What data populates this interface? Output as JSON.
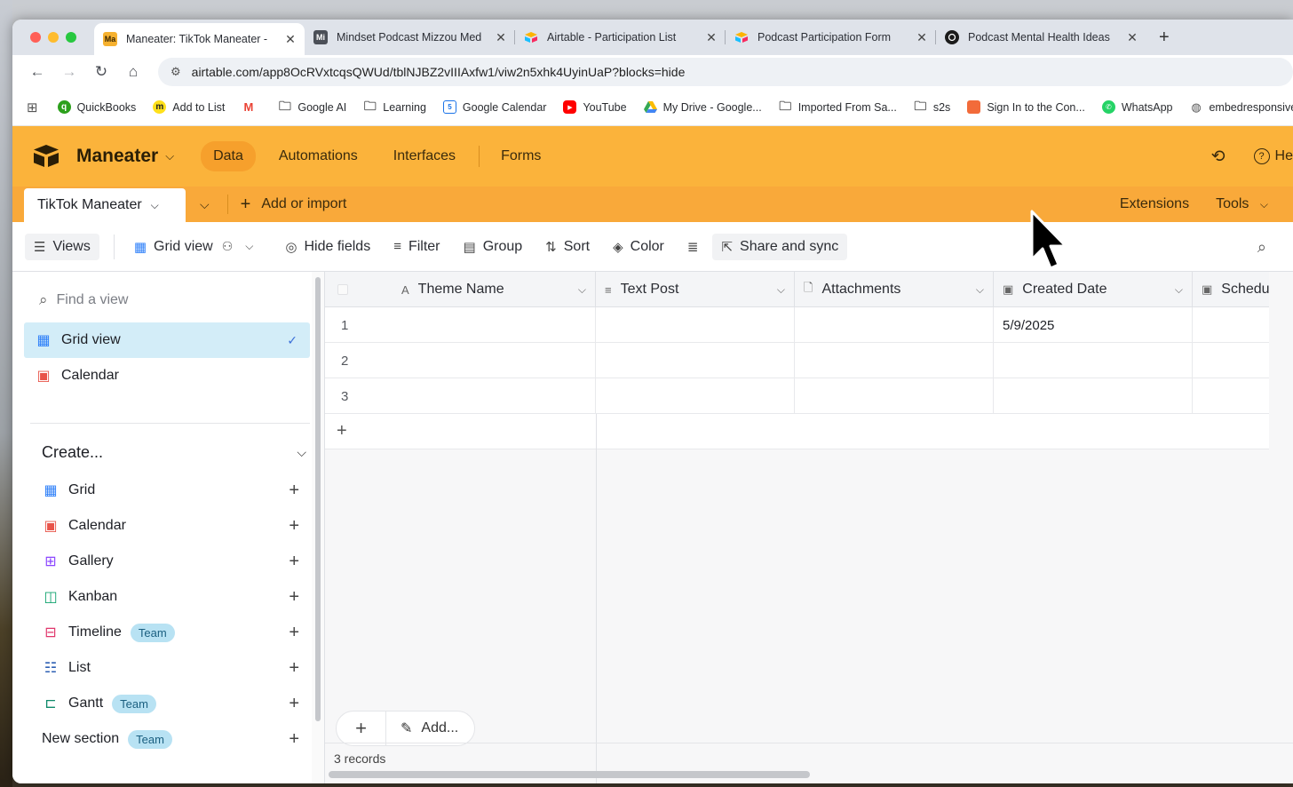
{
  "browser": {
    "tabs": [
      {
        "favicon": "Ma",
        "title": "Maneater: TikTok Maneater -",
        "active": true
      },
      {
        "favicon": "Mi",
        "title": "Mindset Podcast Mizzou Med",
        "active": false
      },
      {
        "favicon": "airtable-icon",
        "title": "Airtable - Participation List",
        "active": false
      },
      {
        "favicon": "airtable-icon",
        "title": "Podcast Participation Form",
        "active": false
      },
      {
        "favicon": "circle-icon",
        "title": "Podcast Mental Health Ideas",
        "active": false
      }
    ],
    "url": "airtable.com/app8OcRVxtcqsQWUd/tblNJBZ2vIIIAxfw1/viw2n5xhk4UyinUaP?blocks=hide",
    "bookmarks": [
      {
        "label": "QuickBooks",
        "icon": "quickbooks-icon",
        "color": "#2ca01c"
      },
      {
        "label": "Add to List",
        "icon": "mailchimp-icon",
        "color": "#222222"
      },
      {
        "label": "",
        "icon": "gmail-icon",
        "color": "#ea4335"
      },
      {
        "label": "Google AI",
        "icon": "folder-icon",
        "color": "#555555"
      },
      {
        "label": "Learning",
        "icon": "folder-icon",
        "color": "#555555"
      },
      {
        "label": "Google Calendar",
        "icon": "google-calendar-icon",
        "color": "#1a73e8"
      },
      {
        "label": "YouTube",
        "icon": "youtube-icon",
        "color": "#ff0000"
      },
      {
        "label": "My Drive - Google...",
        "icon": "google-drive-icon",
        "color": "#34a853"
      },
      {
        "label": "Imported From Sa...",
        "icon": "folder-icon",
        "color": "#555555"
      },
      {
        "label": "s2s",
        "icon": "folder-icon",
        "color": "#555555"
      },
      {
        "label": "Sign In to the Con...",
        "icon": "cube-icon",
        "color": "#f26b3a"
      },
      {
        "label": "WhatsApp",
        "icon": "whatsapp-icon",
        "color": "#25d366"
      },
      {
        "label": "embedresponsive",
        "icon": "globe-icon",
        "color": "#555555"
      }
    ]
  },
  "header": {
    "base_name": "Maneater",
    "nav": [
      "Data",
      "Automations",
      "Interfaces",
      "Forms"
    ],
    "active_nav": "Data",
    "help_label": "He"
  },
  "tables_bar": {
    "active_table": "TikTok Maneater",
    "add_import": "Add or import",
    "extensions": "Extensions",
    "tools": "Tools"
  },
  "viewbar": {
    "views": "Views",
    "grid_view": "Grid view",
    "hide_fields": "Hide fields",
    "filter": "Filter",
    "group": "Group",
    "sort": "Sort",
    "color": "Color",
    "share": "Share and sync"
  },
  "sidebar": {
    "find_placeholder": "Find a view",
    "views": [
      {
        "label": "Grid view",
        "selected": true
      },
      {
        "label": "Calendar",
        "selected": false
      }
    ],
    "create_label": "Create...",
    "create_items": [
      {
        "label": "Grid",
        "badge": ""
      },
      {
        "label": "Calendar",
        "badge": ""
      },
      {
        "label": "Gallery",
        "badge": ""
      },
      {
        "label": "Kanban",
        "badge": ""
      },
      {
        "label": "Timeline",
        "badge": "Team"
      },
      {
        "label": "List",
        "badge": ""
      },
      {
        "label": "Gantt",
        "badge": "Team"
      },
      {
        "label": "New section",
        "badge": "Team"
      }
    ]
  },
  "grid": {
    "columns": [
      "Theme Name",
      "Text Post",
      "Attachments",
      "Created Date",
      "Schedu"
    ],
    "rows": [
      {
        "num": "1",
        "theme": "",
        "text": "",
        "attachments": "",
        "created": "5/9/2025"
      },
      {
        "num": "2",
        "theme": "",
        "text": "",
        "attachments": "",
        "created": ""
      },
      {
        "num": "3",
        "theme": "",
        "text": "",
        "attachments": "",
        "created": ""
      }
    ],
    "add_label": "Add...",
    "records": "3 records"
  },
  "colors": {
    "header_bg": "#fbb33b",
    "tables_bar_bg": "#f9a93a",
    "selected_view_bg": "#d3edf8",
    "team_badge_bg": "#b8e2f3"
  }
}
